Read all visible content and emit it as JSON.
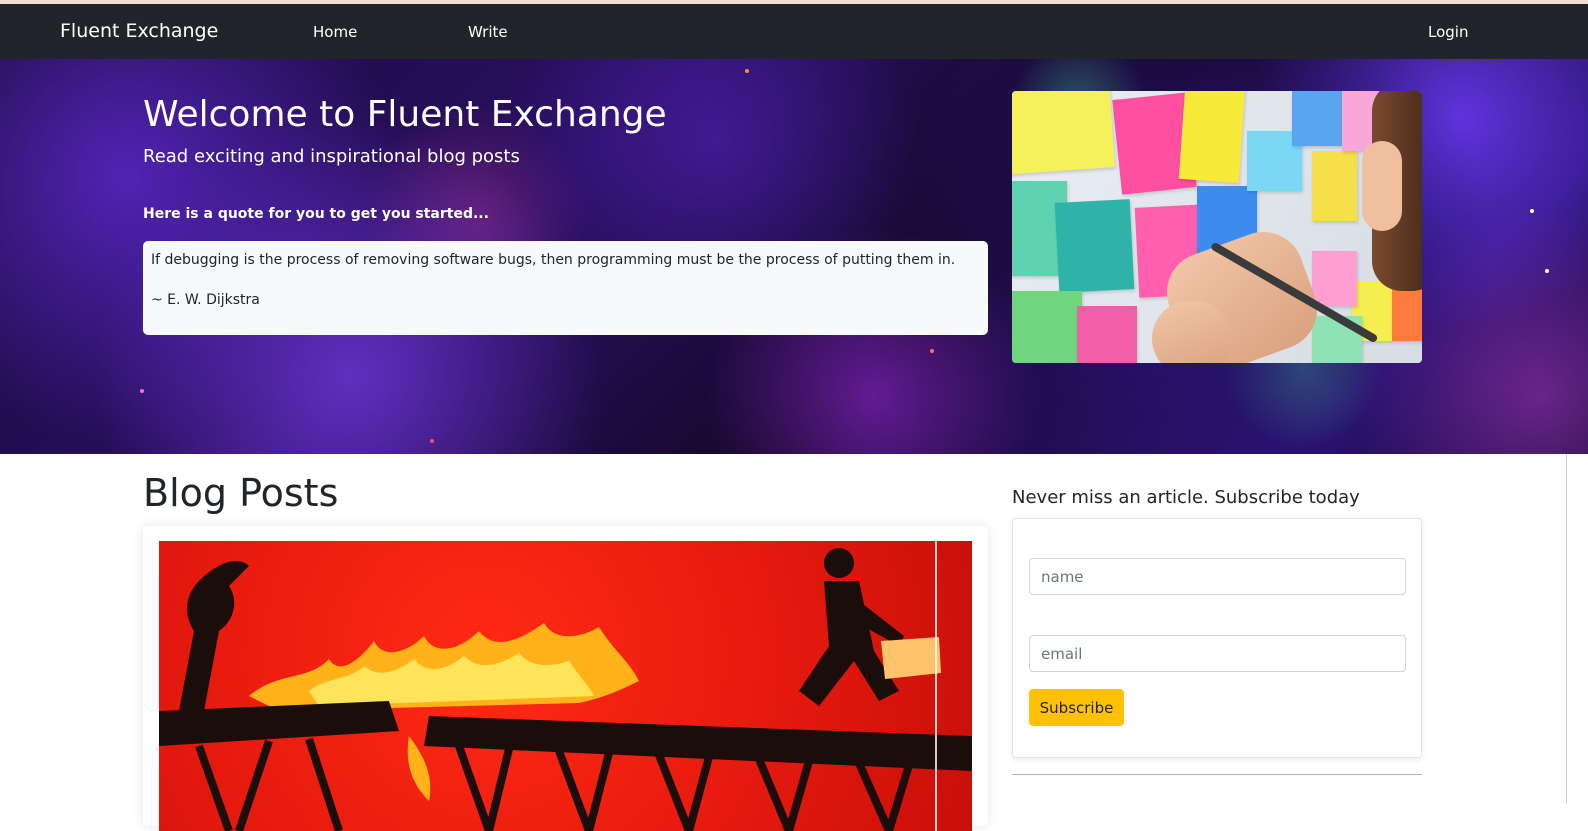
{
  "navbar": {
    "brand": "Fluent Exchange",
    "links": [
      {
        "label": "Home"
      },
      {
        "label": "Write"
      }
    ],
    "login_label": "Login"
  },
  "hero": {
    "title": "Welcome to Fluent Exchange",
    "subtitle": "Read exciting and inspirational blog posts",
    "quote_intro": "Here is a quote for you to get you started...",
    "quote_text": "If debugging is the process of removing software bugs, then programming must be the process of putting them in.",
    "quote_author": "~ E. W. Dijkstra"
  },
  "main": {
    "heading": "Blog Posts"
  },
  "subscribe": {
    "heading": "Never miss an article. Subscribe today",
    "name_placeholder": "name",
    "email_placeholder": "email",
    "button_label": "Subscribe"
  },
  "colors": {
    "navbar_bg": "#212529",
    "button_accent": "#ffc107",
    "quote_box_bg": "#f8f9fa",
    "post_image_red": "#e61a0e"
  },
  "icons": {
    "hero_image": "sticky-notes-photo",
    "post_image": "burning-bridge-illustration"
  }
}
